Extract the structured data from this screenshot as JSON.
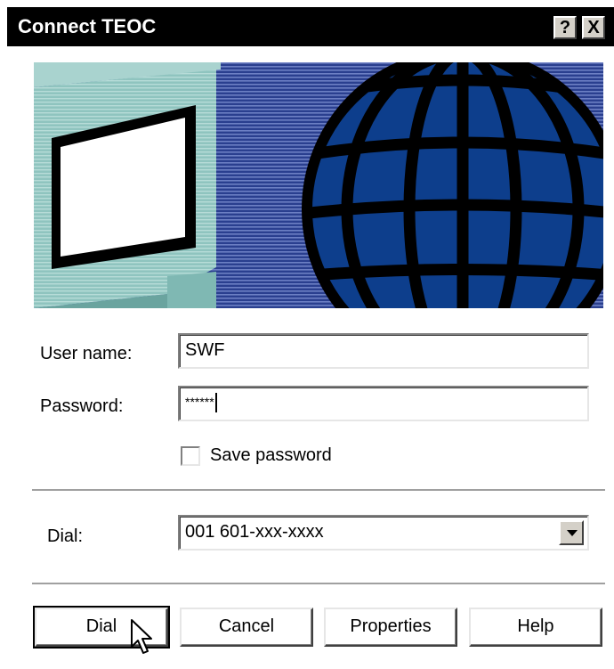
{
  "window": {
    "title": "Connect TEOC",
    "help_button": "?",
    "close_button": "X"
  },
  "form": {
    "username_label": "User name:",
    "username_value": "SWF",
    "password_label": "Password:",
    "password_value": "******",
    "save_password_label": "Save password",
    "save_password_checked": false,
    "dial_label": "Dial:",
    "dial_value": "001 601-xxx-xxxx"
  },
  "buttons": {
    "dial": "Dial",
    "cancel": "Cancel",
    "properties": "Properties",
    "help": "Help"
  },
  "colors": {
    "titlebar": "#000000",
    "banner_blue": "#0a3a8c",
    "monitor_teal": "#8fc4bf"
  }
}
